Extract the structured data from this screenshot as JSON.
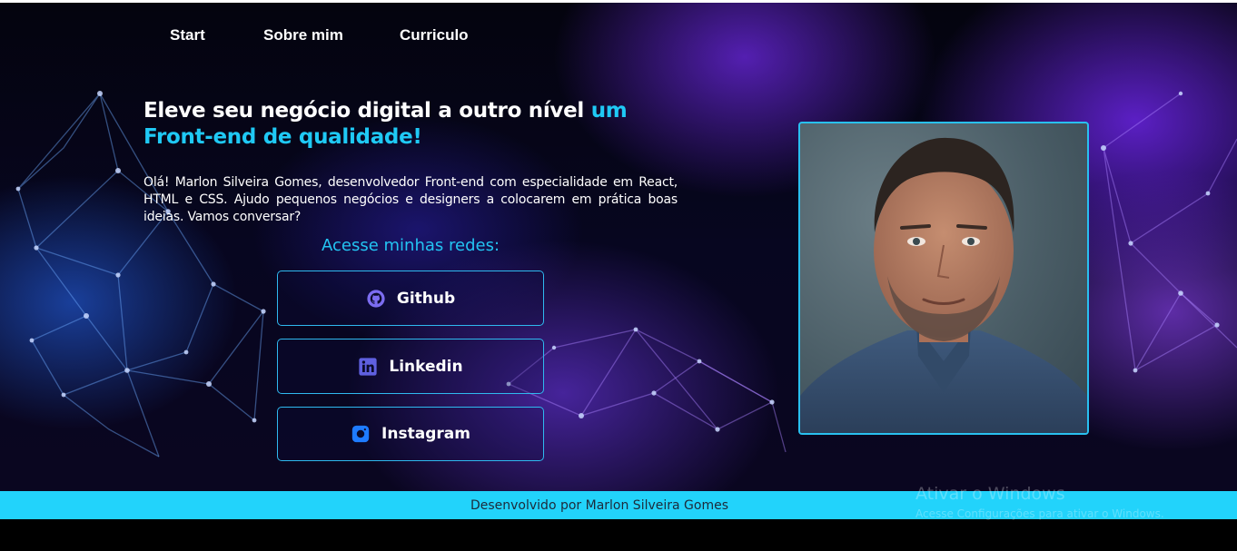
{
  "nav": {
    "start": "Start",
    "about": "Sobre mim",
    "resume": "Curriculo"
  },
  "hero": {
    "headline_plain": "Eleve seu negócio digital a outro nível ",
    "headline_highlight": "um Front-end de qualidade!",
    "intro": "Olá! Marlon Silveira Gomes, desenvolvedor Front-end com especialidade em React, HTML e CSS. Ajudo pequenos negócios e designers a colocarem em prática boas ideias. Vamos conversar?"
  },
  "social": {
    "title": "Acesse minhas redes:",
    "buttons": [
      {
        "label": "Github",
        "icon": "github-icon"
      },
      {
        "label": "Linkedin",
        "icon": "linkedin-icon"
      },
      {
        "label": "Instagram",
        "icon": "instagram-icon"
      }
    ]
  },
  "profile_photo": {
    "subject": "portrait-photo"
  },
  "footer": {
    "text": "Desenvolvido por Marlon Silveira Gomes"
  },
  "watermark": {
    "title": "Ativar o Windows",
    "subtitle": "Acesse Configurações para ativar o Windows."
  },
  "colors": {
    "accent": "#1fc9f5",
    "footer_bg": "#22d3fb",
    "button_border": "#2fb9ef",
    "instagram_icon": "#1e7bff",
    "linkedin_icon": "#5f60e0"
  }
}
